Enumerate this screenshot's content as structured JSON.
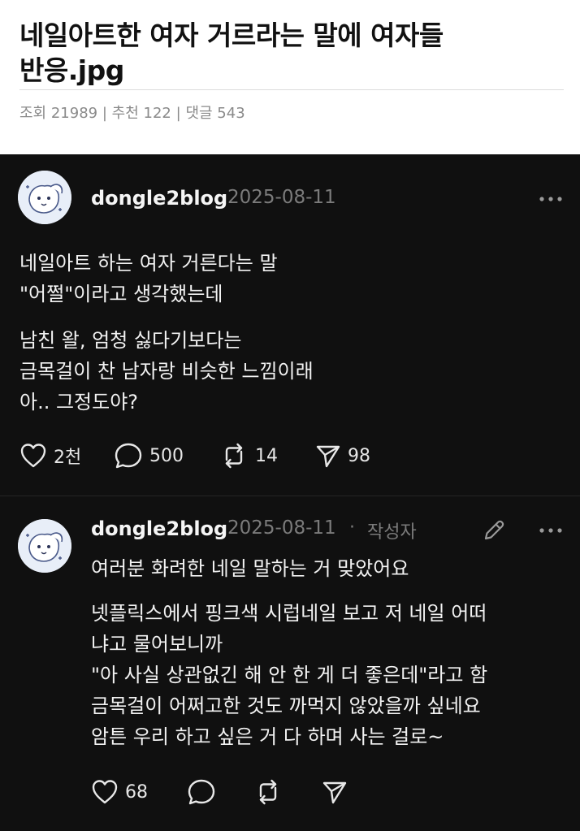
{
  "post": {
    "title_line1": "네일아트한 여자 거르라는 말에 여자들",
    "title_line2": "반응.jpg",
    "meta": {
      "views_label": "조회",
      "views": "21989",
      "likes_label": "추천",
      "likes": "122",
      "comments_label": "댓글",
      "comments": "543",
      "separator": "|"
    }
  },
  "thread": [
    {
      "username": "dongle2blog",
      "date": "2025-08-11",
      "author_tag": "",
      "lines": [
        "네일아트 하는 여자 거른다는 말",
        "\"어쩔\"이라고 생각했는데",
        "남친 왈, 엄청 싫다기보다는",
        "금목걸이 찬 남자랑 비슷한 느낌이래",
        "아.. 그정도야?"
      ],
      "likes": "2천",
      "replies": "500",
      "reposts": "14",
      "shares": "98"
    },
    {
      "username": "dongle2blog",
      "date": "2025-08-11",
      "author_tag_separator": "·",
      "author_tag": "작성자",
      "lines": [
        "여러분 화려한 네일 말하는 거 맞았어요",
        "넷플릭스에서 핑크색 시럽네일 보고 저 네일 어떠",
        "냐고 물어보니까",
        "\"아 사실 상관없긴 해 안 한 게 더 좋은데\"라고 함",
        "금목걸이 어쩌고한 것도 까먹지 않았을까 싶네요",
        "암튼 우리 하고 싶은 거 다 하며 사는 걸로~"
      ],
      "likes": "68"
    }
  ],
  "icons": {
    "like": "heart-icon",
    "reply": "comment-icon",
    "repost": "repost-icon",
    "share": "send-icon",
    "more": "more-icon",
    "edit": "pencil-icon"
  }
}
